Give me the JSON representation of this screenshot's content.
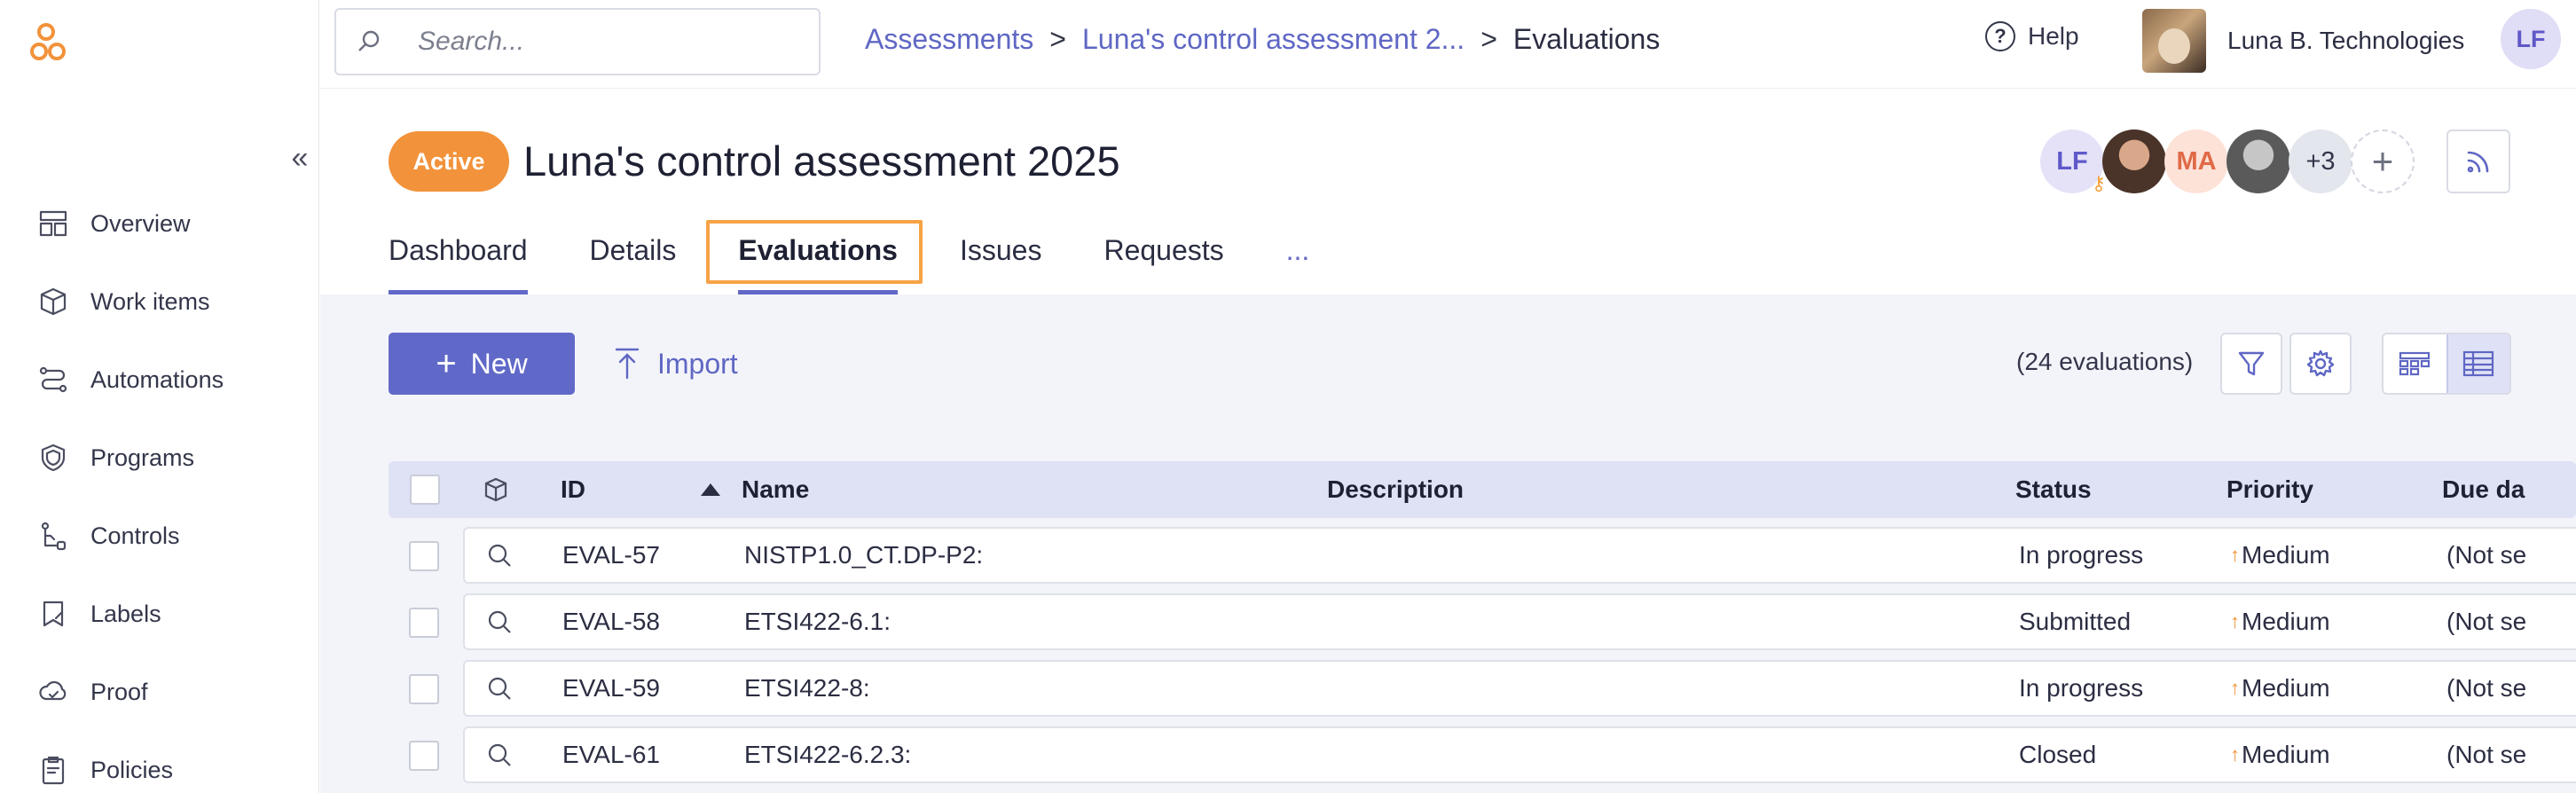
{
  "search": {
    "placeholder": "Search..."
  },
  "breadcrumbs": {
    "items": [
      "Assessments",
      "Luna's control assessment 2...",
      "Evaluations"
    ],
    "separator": ">"
  },
  "header": {
    "help_label": "Help",
    "org_name": "Luna B. Technologies",
    "user_initials": "LF"
  },
  "sidebar": {
    "collapse_glyph": "«",
    "items": [
      {
        "label": "Overview",
        "icon": "overview-icon"
      },
      {
        "label": "Work items",
        "icon": "box-icon"
      },
      {
        "label": "Automations",
        "icon": "automations-icon"
      },
      {
        "label": "Programs",
        "icon": "shield-icon"
      },
      {
        "label": "Controls",
        "icon": "controls-icon"
      },
      {
        "label": "Labels",
        "icon": "label-icon"
      },
      {
        "label": "Proof",
        "icon": "cloud-icon"
      },
      {
        "label": "Policies",
        "icon": "policy-icon"
      }
    ]
  },
  "page": {
    "status": "Active",
    "title": "Luna's control assessment 2025",
    "members": {
      "first_initials": "LF",
      "second_initials": "MA",
      "more": "+3",
      "add": "+"
    }
  },
  "tabs": {
    "items": [
      "Dashboard",
      "Details",
      "Evaluations",
      "Issues",
      "Requests"
    ],
    "more": "...",
    "selected": "Evaluations"
  },
  "toolbar": {
    "new_label": "New",
    "new_plus": "+",
    "import_label": "Import",
    "count_text": "(24 evaluations)"
  },
  "table": {
    "columns": {
      "id": "ID",
      "name": "Name",
      "description": "Description",
      "status": "Status",
      "priority": "Priority",
      "due": "Due da"
    },
    "rows": [
      {
        "id": "EVAL-57",
        "name": "NISTP1.0_CT.DP-P2:",
        "description": "",
        "status": "In progress",
        "priority": "Medium",
        "due": "(Not se"
      },
      {
        "id": "EVAL-58",
        "name": "ETSI422-6.1:",
        "description": "",
        "status": "Submitted",
        "priority": "Medium",
        "due": "(Not se"
      },
      {
        "id": "EVAL-59",
        "name": "ETSI422-8:",
        "description": "",
        "status": "In progress",
        "priority": "Medium",
        "due": "(Not se"
      },
      {
        "id": "EVAL-61",
        "name": "ETSI422-6.2.3:",
        "description": "",
        "status": "Closed",
        "priority": "Medium",
        "due": "(Not se"
      }
    ]
  },
  "colors": {
    "accent": "#6169c8",
    "link": "#5f67c4",
    "status_active": "#f2923a",
    "tab_highlight": "#f6a346",
    "priority_medium": "#f2923a"
  }
}
